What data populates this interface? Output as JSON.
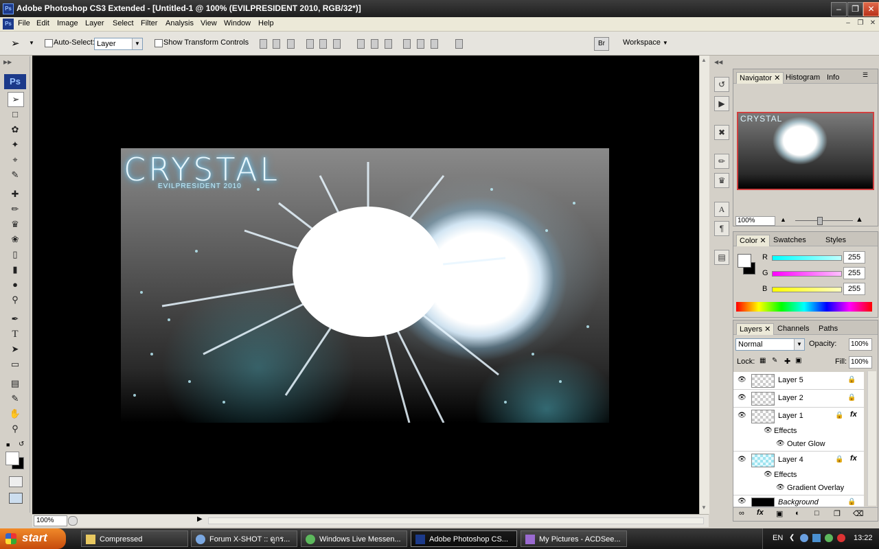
{
  "window": {
    "title": "Adobe Photoshop CS3 Extended - [Untitled-1 @ 100% (EVILPRESIDENT 2010, RGB/32*)]",
    "app_icon": "Ps"
  },
  "menu": [
    "File",
    "Edit",
    "Image",
    "Layer",
    "Select",
    "Filter",
    "Analysis",
    "View",
    "Window",
    "Help"
  ],
  "options": {
    "auto_select_label": "Auto-Select:",
    "auto_select_value": "Layer",
    "transform_label": "Show Transform Controls",
    "workspace_label": "Workspace"
  },
  "toolbox": {
    "ps_logo": "Ps"
  },
  "canvas": {
    "title_text": "CRYSTAL",
    "subtitle_text": "EVILPRESIDENT 2010"
  },
  "status": {
    "zoom": "100%"
  },
  "navigator": {
    "tabs": [
      "Navigator",
      "Histogram",
      "Info"
    ],
    "thumb_title": "CRYSTAL",
    "zoom": "100%"
  },
  "color": {
    "tabs": [
      "Color",
      "Swatches",
      "Styles"
    ],
    "channels": [
      {
        "label": "R",
        "value": "255",
        "color": "#00e0e0"
      },
      {
        "label": "G",
        "value": "255",
        "color": "#e000e0"
      },
      {
        "label": "B",
        "value": "255",
        "color": "#e0e000"
      }
    ]
  },
  "layers": {
    "tabs": [
      "Layers",
      "Channels",
      "Paths"
    ],
    "blend_mode": "Normal",
    "opacity_label": "Opacity:",
    "opacity": "100%",
    "lock_label": "Lock:",
    "fill_label": "Fill:",
    "fill": "100%",
    "items": [
      {
        "name": "Layer 5"
      },
      {
        "name": "Layer 2"
      },
      {
        "name": "Layer 1",
        "effects_label": "Effects",
        "effect": "Outer Glow"
      },
      {
        "name": "Layer 4",
        "effects_label": "Effects",
        "effect": "Gradient Overlay"
      },
      {
        "name": "Background"
      }
    ]
  },
  "taskbar": {
    "start": "start",
    "tasks": [
      "Compressed",
      "Forum X-SHOT :: ดูกร...",
      "Windows Live Messen...",
      "Adobe Photoshop CS...",
      "My Pictures - ACDSee..."
    ],
    "lang": "EN",
    "time": "13:22"
  }
}
